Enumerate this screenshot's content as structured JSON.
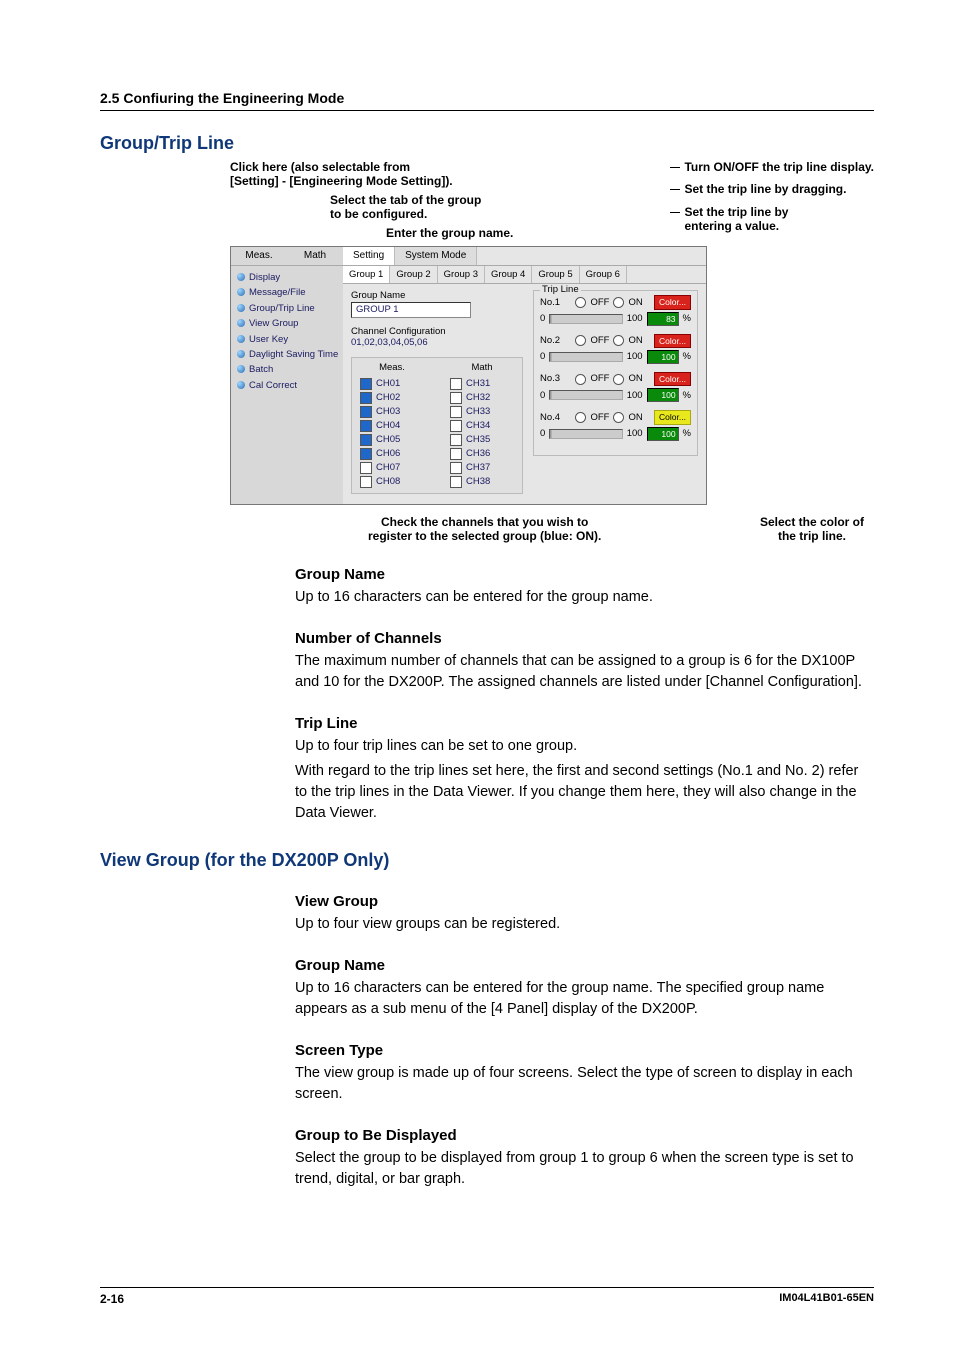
{
  "header": {
    "section": "2.5  Confiuring the Engineering Mode"
  },
  "h_group": "Group/Trip Line",
  "fig_anno": {
    "click_here": "Click here (also selectable from\n[Setting] - [Engineering Mode Setting]).",
    "select_tab": "Select the tab of the group\nto be configured.",
    "enter_name": "Enter the group name.",
    "turn_onoff": "Turn ON/OFF the trip line display.",
    "set_drag": "Set the trip line by dragging.",
    "set_value": "Set the trip line by\nentering a value.",
    "check_ch": "Check the channels that you wish to\nregister to the selected group (blue: ON).",
    "select_color": "Select the color of\nthe trip line."
  },
  "shot": {
    "left_tabs": {
      "meas": "Meas.",
      "math": "Math"
    },
    "tree": [
      "Display",
      "Message/File",
      "Group/Trip Line",
      "View Group",
      "User Key",
      "Daylight Saving Time",
      "Batch",
      "Cal Correct"
    ],
    "mid_tabs": {
      "setting": "Setting",
      "system": "System Mode"
    },
    "group_tabs": [
      "Group 1",
      "Group 2",
      "Group 3",
      "Group 4",
      "Group 5",
      "Group 6"
    ],
    "gname_label": "Group Name",
    "gname_value": "GROUP 1",
    "chconf_label": "Channel Configuration",
    "chconf_value": "01,02,03,04,05,06",
    "col_meas": "Meas.",
    "col_math": "Math",
    "meas_rows": [
      "CH01",
      "CH02",
      "CH03",
      "CH04",
      "CH05",
      "CH06",
      "CH07",
      "CH08"
    ],
    "math_rows": [
      "CH31",
      "CH32",
      "CH33",
      "CH34",
      "CH35",
      "CH36",
      "CH37",
      "CH38"
    ],
    "meas_on": [
      true,
      true,
      true,
      true,
      true,
      true,
      false,
      false
    ],
    "trip_legend": "Trip Line",
    "trips": [
      {
        "no": "No.1",
        "off": "OFF",
        "on": "ON",
        "min": "0",
        "max": "100",
        "val": "83",
        "pct": "%",
        "color": "Color...",
        "class": ""
      },
      {
        "no": "No.2",
        "off": "OFF",
        "on": "ON",
        "min": "0",
        "max": "100",
        "val": "100",
        "pct": "%",
        "color": "Color...",
        "class": ""
      },
      {
        "no": "No.3",
        "off": "OFF",
        "on": "ON",
        "min": "0",
        "max": "100",
        "val": "100",
        "pct": "%",
        "color": "Color...",
        "class": ""
      },
      {
        "no": "No.4",
        "off": "OFF",
        "on": "ON",
        "min": "0",
        "max": "100",
        "val": "100",
        "pct": "%",
        "color": "Color...",
        "class": "y"
      }
    ]
  },
  "s_gn_h": "Group Name",
  "s_gn_p": "Up to 16 characters can be entered for the group name.",
  "s_nc_h": "Number of Channels",
  "s_nc_p": "The maximum number of channels that can be assigned to a group is 6 for the DX100P and 10 for the DX200P. The assigned channels are listed under [Channel Configuration].",
  "s_tl_h": "Trip Line",
  "s_tl_p1": "Up to four trip lines can be set to one group.",
  "s_tl_p2": "With regard to the trip lines set here, the first and second settings (No.1 and No. 2) refer to the trip lines in the Data Viewer. If you change them here, they will also change in the Data Viewer.",
  "h_view": "View Group (for the DX200P Only)",
  "s_vg_h": "View Group",
  "s_vg_p": "Up to four view groups can be registered.",
  "s_vgn_h": "Group Name",
  "s_vgn_p": "Up to 16 characters can be entered for the group name. The specified group name appears as a sub menu of the [4 Panel] display of the DX200P.",
  "s_st_h": "Screen Type",
  "s_st_p": "The view group is made up of four screens. Select the type of screen to display in each screen.",
  "s_gd_h": "Group to Be Displayed",
  "s_gd_p": "Select the group to be displayed from group 1 to group 6 when the screen type is set to trend, digital, or bar graph.",
  "footer": {
    "page": "2-16",
    "docid": "IM04L41B01-65EN"
  }
}
